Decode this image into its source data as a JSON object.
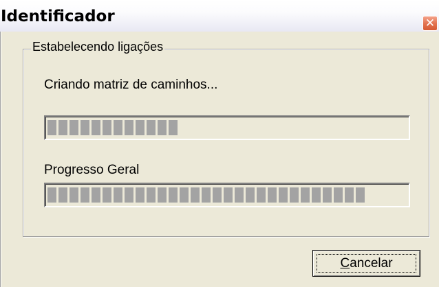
{
  "window": {
    "title": "Identificador",
    "close_symbol": "✕"
  },
  "group": {
    "title": "Estabelecendo ligações",
    "status_text": "Criando matriz de caminhos...",
    "step_progress": 0.38,
    "overall_label": "Progresso Geral",
    "overall_progress": 0.88
  },
  "buttons": {
    "cancel_mnemonic": "C",
    "cancel_rest": "ancelar"
  },
  "icons": {
    "close": "close-icon"
  },
  "colors": {
    "progress_block": "#a3a3a3",
    "close_button": "#e2714e",
    "window_bg": "#ece9d8"
  }
}
